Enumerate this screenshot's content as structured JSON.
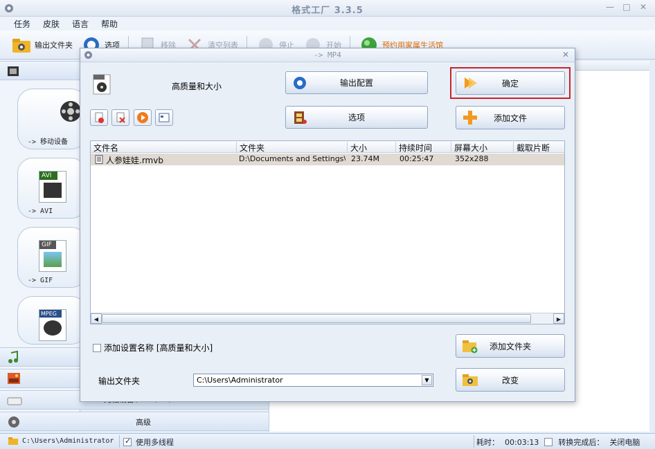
{
  "window": {
    "title": "格式工厂 3.3.5",
    "controls": [
      "—",
      "□",
      "✕"
    ]
  },
  "menu": [
    "任务",
    "皮肤",
    "语言",
    "帮助"
  ],
  "toolbar": {
    "output_folder": "输出文件夹",
    "options": "选项",
    "remove": "移除",
    "clear_list": "清空列表",
    "stop": "停止",
    "start": "开始",
    "promo": "预约用家属生活馆"
  },
  "left_panel": {
    "tiles": [
      "-> 移动设备",
      "-> AVI",
      "-> GIF"
    ],
    "mpeg_badge": "MPEG",
    "avi_badge": "AVI",
    "gif_badge": "GIF",
    "advanced": "高级",
    "behind_text": "光驱设备\\DVD\\CD\\ISO"
  },
  "dialog": {
    "title": "-> MP4",
    "profile": "高质量和大小",
    "btn_output_config": "输出配置",
    "btn_ok": "确定",
    "btn_options": "选项",
    "btn_add_file": "添加文件",
    "btn_add_folder": "添加文件夹",
    "btn_change": "改变",
    "add_setting_name": "添加设置名称 [高质量和大小]",
    "output_folder_label": "输出文件夹",
    "output_folder_value": "C:\\Users\\Administrator",
    "columns": [
      "文件名",
      "文件夹",
      "大小",
      "持续时间",
      "屏幕大小",
      "截取片断"
    ],
    "rows": [
      [
        "人参娃娃.rmvb",
        "D:\\Documents and Settings\\...",
        "23.74M",
        "00:25:47",
        "352x288",
        ""
      ]
    ]
  },
  "status": {
    "path": "C:\\Users\\Administrator",
    "multithread": "使用多线程",
    "elapsed_label": "耗时：",
    "elapsed": "00:03:13",
    "after_done": "转换完成后：",
    "after_action": "关闭电脑"
  }
}
